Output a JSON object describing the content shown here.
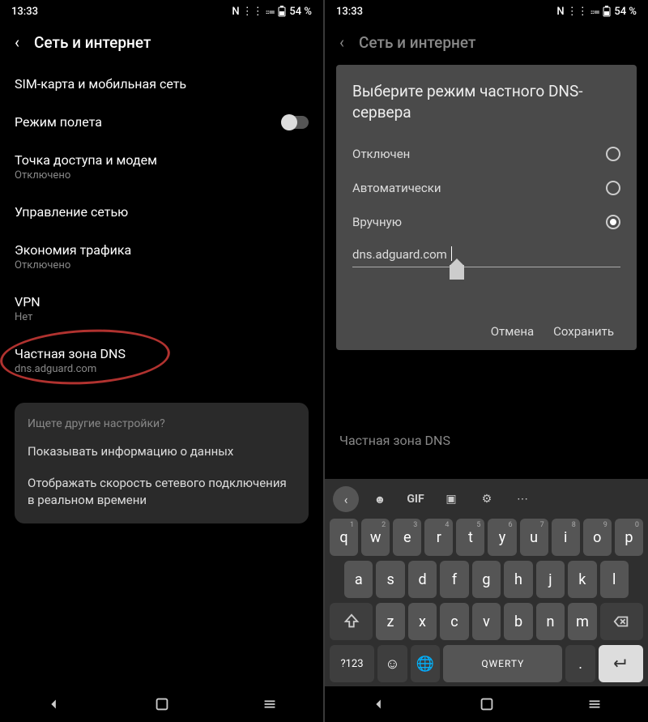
{
  "status": {
    "time": "13:33",
    "icons": "N ⋮⋮ ⩴",
    "battery": "54 %"
  },
  "left": {
    "header": "Сеть и интернет",
    "items": {
      "sim": "SIM-карта и мобильная сеть",
      "airplane": "Режим полета",
      "hotspot": {
        "label": "Точка доступа и модем",
        "sub": "Отключено"
      },
      "manage": "Управление сетью",
      "saver": {
        "label": "Экономия трафика",
        "sub": "Отключено"
      },
      "vpn": {
        "label": "VPN",
        "sub": "Нет"
      },
      "dns": {
        "label": "Частная зона DNS",
        "sub": "dns.adguard.com"
      }
    },
    "suggest": {
      "hint": "Ищете другие настройки?",
      "s1": "Показывать информацию о данных",
      "s2": "Отображать скорость сетевого подключения в реальном времени"
    }
  },
  "right": {
    "header": "Сеть и интернет",
    "modal": {
      "title": "Выберите режим частного DNS-сервера",
      "opt_off": "Отключен",
      "opt_auto": "Автоматически",
      "opt_manual": "Вручную",
      "input": "dns.adguard.com",
      "cancel": "Отмена",
      "save": "Сохранить"
    },
    "dns_peek": "Частная зона DNS"
  },
  "kbd": {
    "gif": "GIF",
    "row1": [
      "q",
      "w",
      "e",
      "r",
      "t",
      "y",
      "u",
      "i",
      "o",
      "p"
    ],
    "row1sup": [
      "1",
      "2",
      "3",
      "4",
      "5",
      "6",
      "7",
      "8",
      "9",
      "0"
    ],
    "row2": [
      "a",
      "s",
      "d",
      "f",
      "g",
      "h",
      "j",
      "k",
      "l"
    ],
    "row3": [
      "z",
      "x",
      "c",
      "v",
      "b",
      "n",
      "m"
    ],
    "num": "?123",
    "space": "QWERTY"
  }
}
